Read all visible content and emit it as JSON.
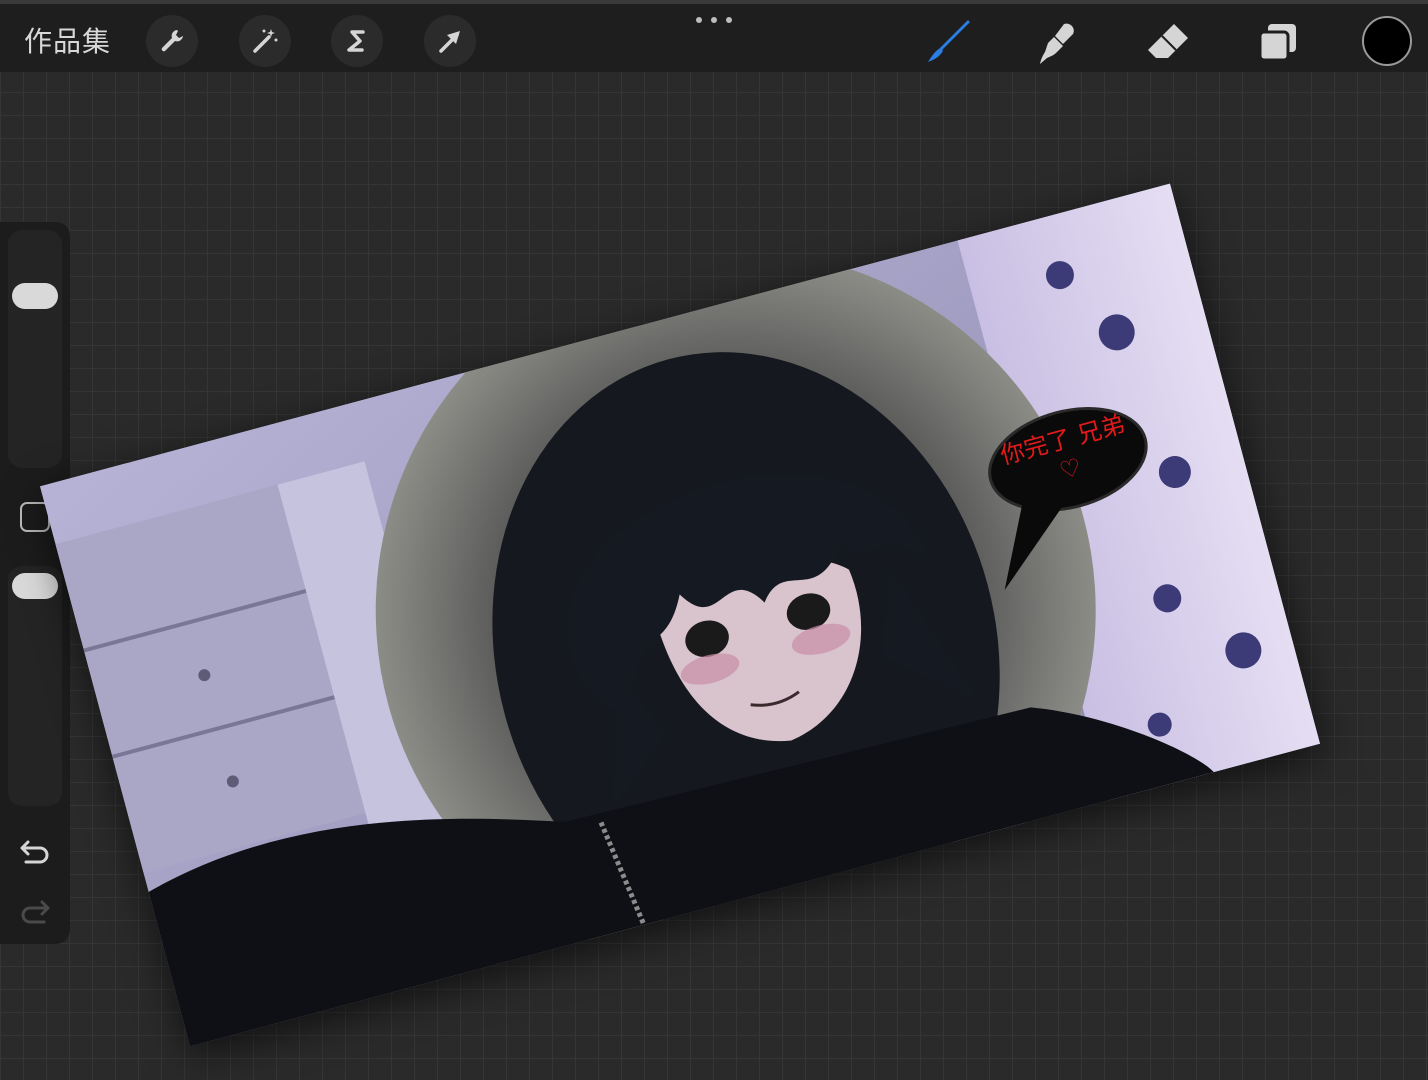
{
  "topbar": {
    "gallery_label": "作品集",
    "left_tools": [
      "wrench-icon",
      "magic-wand-icon",
      "selection-icon",
      "transform-arrow-icon"
    ],
    "right_tools": [
      "brush-icon",
      "smudge-icon",
      "eraser-icon",
      "layers-icon"
    ],
    "active_tool": "brush-icon",
    "active_color": "#000000",
    "accent_color": "#2a7de1"
  },
  "sidebar": {
    "brush_size_level": 0.93,
    "opacity_level": 1.0,
    "icons": [
      "modify-square-icon",
      "undo-icon",
      "redo-icon"
    ]
  },
  "canvas": {
    "speech_bubble_text": "你完了 兄弟♡",
    "text_color": "#e01a1a"
  }
}
